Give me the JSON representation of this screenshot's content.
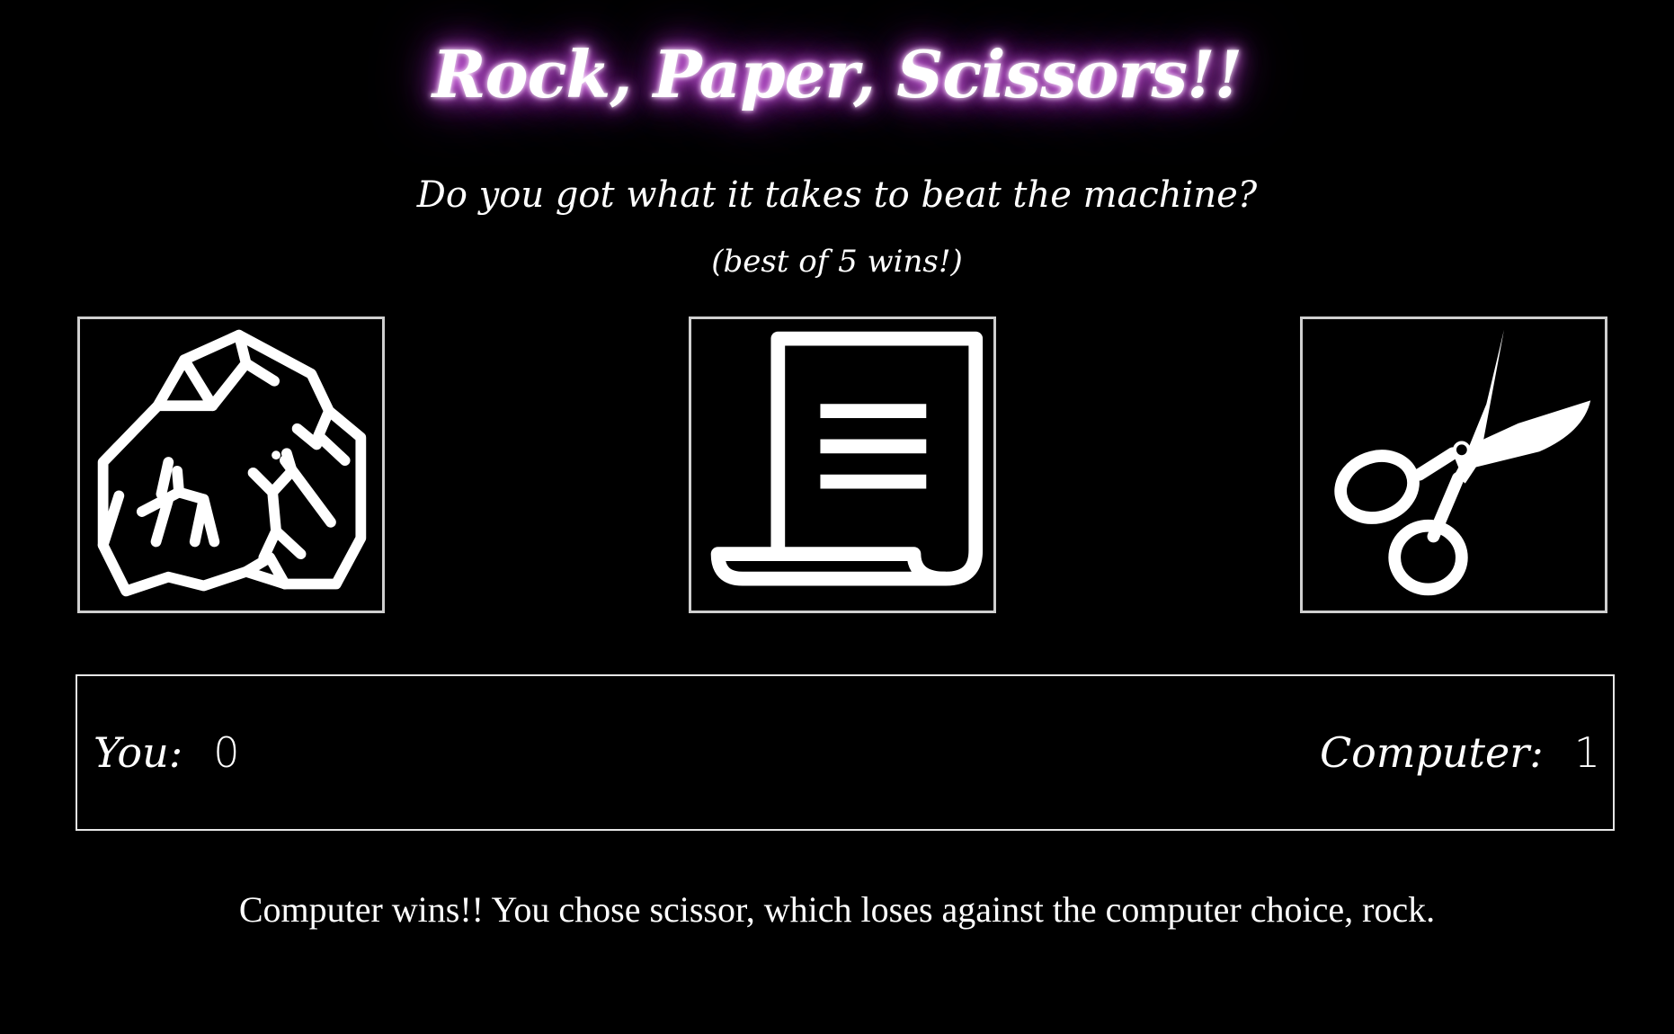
{
  "header": {
    "title": "Rock, Paper, Scissors!!",
    "subtitle": "Do you got what it takes to beat the machine?",
    "note": "(best of 5 wins!)"
  },
  "choices": [
    {
      "name": "rock",
      "icon": "rock-icon"
    },
    {
      "name": "paper",
      "icon": "paper-icon"
    },
    {
      "name": "scissors",
      "icon": "scissors-icon"
    }
  ],
  "scoreboard": {
    "you_label": "You:",
    "you_score": "0",
    "computer_label": "Computer:",
    "computer_score": "1"
  },
  "result": "Computer wins!! You chose scissor, which loses against the computer choice, rock.",
  "colors": {
    "background": "#000000",
    "text": "#ffffff",
    "glow": "#b73fd0",
    "border": "#cfcfcf"
  }
}
